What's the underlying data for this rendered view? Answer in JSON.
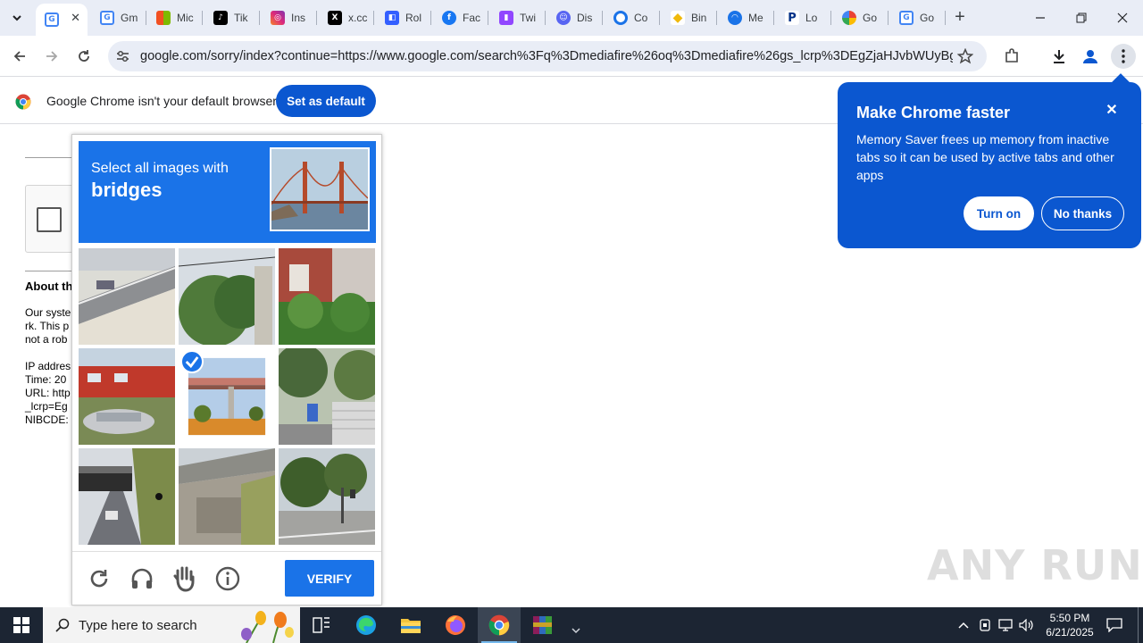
{
  "tabs": [
    {
      "label": "G",
      "icon": "google-icon",
      "active": true
    },
    {
      "label": "Gm",
      "icon": "google-icon"
    },
    {
      "label": "Mic",
      "icon": "microsoft-icon"
    },
    {
      "label": "Tik",
      "icon": "tiktok-icon"
    },
    {
      "label": "Ins",
      "icon": "instagram-icon"
    },
    {
      "label": "x.cc",
      "icon": "x-icon"
    },
    {
      "label": "Rol",
      "icon": "roblox-icon"
    },
    {
      "label": "Fac",
      "icon": "facebook-icon"
    },
    {
      "label": "Twi",
      "icon": "twitch-icon"
    },
    {
      "label": "Dis",
      "icon": "discord-icon"
    },
    {
      "label": "Co",
      "icon": "copilot-icon"
    },
    {
      "label": "Bin",
      "icon": "binance-icon"
    },
    {
      "label": "Me",
      "icon": "mega-icon"
    },
    {
      "label": "Lo",
      "icon": "paypal-icon"
    },
    {
      "label": "Go",
      "icon": "google-photos-icon"
    },
    {
      "label": "Go",
      "icon": "google-icon"
    }
  ],
  "toolbar": {
    "url": "google.com/sorry/index?continue=https://www.google.com/search%3Fq%3Dmediafire%26oq%3Dmediafire%26gs_lcrp%3DEgZjaHJvbWUyBggA..."
  },
  "infobar": {
    "message": "Google Chrome isn't your default browser",
    "button": "Set as default"
  },
  "page": {
    "about_heading": "About th",
    "para_lines": [
      "Our syste",
      "rk. This p",
      "not a rob"
    ],
    "info_lines": [
      "IP addres",
      "Time: 20",
      "URL: http",
      "_lcrp=Eg",
      "NIBCDE:"
    ]
  },
  "captcha": {
    "instruction": "Select all images with",
    "target": "bridges",
    "verify_label": "VERIFY",
    "selected_tiles": [
      4
    ]
  },
  "bubble": {
    "title": "Make Chrome faster",
    "body": "Memory Saver frees up memory from inactive tabs so it can be used by active tabs and other apps",
    "turn_on": "Turn on",
    "no_thanks": "No thanks"
  },
  "watermark": "ANY RUN",
  "taskbar": {
    "search_placeholder": "Type here to search",
    "time": "5:50 PM",
    "date": "6/21/2025"
  }
}
